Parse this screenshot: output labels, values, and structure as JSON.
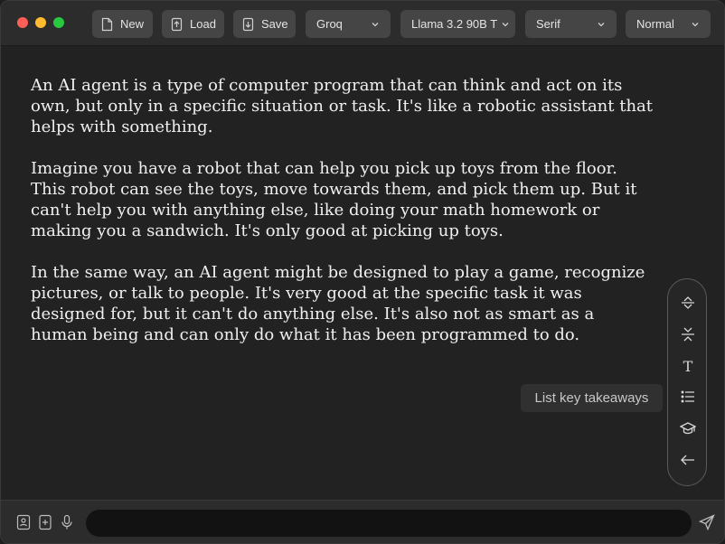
{
  "toolbar": {
    "new_label": "New",
    "load_label": "Load",
    "save_label": "Save",
    "provider": "Groq",
    "model": "Llama 3.2 90B T",
    "font": "Serif",
    "size": "Normal"
  },
  "content": {
    "paragraphs": [
      "An AI agent is a type of computer program that can think and act on its own, but only in a specific situation or task. It's like a robotic assistant that helps with something.",
      "Imagine you have a robot that can help you pick up toys from the floor. This robot can see the toys, move towards them, and pick them up. But it can't help you with anything else, like doing your math homework or making you a sandwich. It's only good at picking up toys.",
      "In the same way, an AI agent might be designed to play a game, recognize pictures, or talk to people. It's very good at the specific task it was designed for, but it can't do anything else. It's also not as smart as a human being and can only do what it has been programmed to do."
    ]
  },
  "toolpanel": {
    "tools": [
      "expand-icon",
      "collapse-icon",
      "text-icon",
      "list-icon",
      "graduation-cap-icon",
      "back-arrow-icon"
    ],
    "text_tool_glyph": "T",
    "tooltip": "List key takeaways"
  },
  "bottombar": {
    "input_value": "",
    "input_placeholder": ""
  }
}
